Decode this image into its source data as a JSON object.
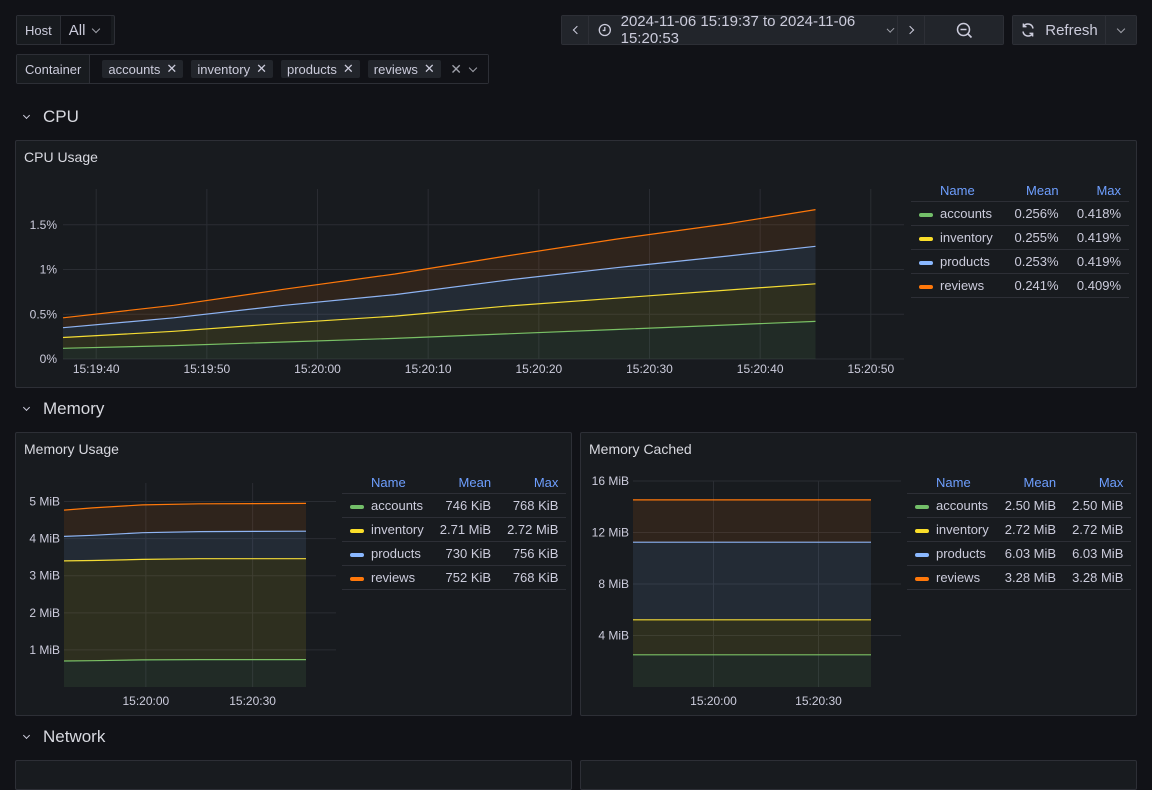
{
  "variables": {
    "host": {
      "label": "Host",
      "value": "All"
    },
    "container": {
      "label": "Container",
      "chips": [
        "accounts",
        "inventory",
        "products",
        "reviews"
      ]
    }
  },
  "toolbar": {
    "time_range": "2024-11-06 15:19:37 to 2024-11-06 15:20:53",
    "refresh_label": "Refresh"
  },
  "series_colors": {
    "accounts": "#73bf69",
    "inventory": "#fade2a",
    "products": "#8ab8ff",
    "reviews": "#ff780a"
  },
  "sections": [
    {
      "title": "CPU"
    },
    {
      "title": "Memory"
    },
    {
      "title": "Network"
    }
  ],
  "panels": {
    "cpu_usage": {
      "title": "CPU Usage",
      "legend": {
        "headers": [
          "Name",
          "Mean",
          "Max"
        ],
        "rows": [
          {
            "name": "accounts",
            "mean": "0.256%",
            "max": "0.418%"
          },
          {
            "name": "inventory",
            "mean": "0.255%",
            "max": "0.419%"
          },
          {
            "name": "products",
            "mean": "0.253%",
            "max": "0.419%"
          },
          {
            "name": "reviews",
            "mean": "0.241%",
            "max": "0.409%"
          }
        ]
      }
    },
    "memory_usage": {
      "title": "Memory Usage",
      "legend": {
        "headers": [
          "Name",
          "Mean",
          "Max"
        ],
        "rows": [
          {
            "name": "accounts",
            "mean": "746 KiB",
            "max": "768 KiB"
          },
          {
            "name": "inventory",
            "mean": "2.71 MiB",
            "max": "2.72 MiB"
          },
          {
            "name": "products",
            "mean": "730 KiB",
            "max": "756 KiB"
          },
          {
            "name": "reviews",
            "mean": "752 KiB",
            "max": "768 KiB"
          }
        ]
      }
    },
    "memory_cached": {
      "title": "Memory Cached",
      "legend": {
        "headers": [
          "Name",
          "Mean",
          "Max"
        ],
        "rows": [
          {
            "name": "accounts",
            "mean": "2.50 MiB",
            "max": "2.50 MiB"
          },
          {
            "name": "inventory",
            "mean": "2.72 MiB",
            "max": "2.72 MiB"
          },
          {
            "name": "products",
            "mean": "6.03 MiB",
            "max": "6.03 MiB"
          },
          {
            "name": "reviews",
            "mean": "3.28 MiB",
            "max": "3.28 MiB"
          }
        ]
      }
    }
  },
  "chart_data": [
    {
      "id": "cpu",
      "type": "area",
      "stacked": true,
      "title": "CPU Usage",
      "x_seconds": [
        0,
        10,
        20,
        30,
        40,
        50,
        60,
        68
      ],
      "x_origin": "15:19:37",
      "xlim": [
        0,
        76
      ],
      "xticks": [
        {
          "t": 3,
          "label": "15:19:40"
        },
        {
          "t": 13,
          "label": "15:19:50"
        },
        {
          "t": 23,
          "label": "15:20:00"
        },
        {
          "t": 33,
          "label": "15:20:10"
        },
        {
          "t": 43,
          "label": "15:20:20"
        },
        {
          "t": 53,
          "label": "15:20:30"
        },
        {
          "t": 63,
          "label": "15:20:40"
        },
        {
          "t": 73,
          "label": "15:20:50"
        }
      ],
      "ylim": [
        0,
        1.9
      ],
      "yticks": [
        {
          "v": 0,
          "label": "0%"
        },
        {
          "v": 0.5,
          "label": "0.5%"
        },
        {
          "v": 1,
          "label": "1%"
        },
        {
          "v": 1.5,
          "label": "1.5%"
        }
      ],
      "series": [
        {
          "name": "accounts",
          "values": [
            0.12,
            0.15,
            0.19,
            0.23,
            0.28,
            0.33,
            0.38,
            0.42
          ]
        },
        {
          "name": "inventory",
          "values": [
            0.12,
            0.16,
            0.21,
            0.25,
            0.31,
            0.35,
            0.39,
            0.42
          ]
        },
        {
          "name": "products",
          "values": [
            0.11,
            0.15,
            0.2,
            0.24,
            0.29,
            0.34,
            0.38,
            0.42
          ]
        },
        {
          "name": "reviews",
          "values": [
            0.11,
            0.14,
            0.18,
            0.23,
            0.27,
            0.32,
            0.36,
            0.41
          ]
        }
      ]
    },
    {
      "id": "memusage",
      "type": "area",
      "stacked": true,
      "title": "Memory Usage",
      "x_seconds": [
        0,
        8,
        22,
        38,
        68
      ],
      "xlim": [
        0,
        68
      ],
      "xticks": [
        {
          "t": 23,
          "label": "15:20:00"
        },
        {
          "t": 53,
          "label": "15:20:30"
        }
      ],
      "ylim": [
        0,
        5.5
      ],
      "yticks": [
        {
          "v": 1,
          "label": "1 MiB"
        },
        {
          "v": 2,
          "label": "2 MiB"
        },
        {
          "v": 3,
          "label": "3 MiB"
        },
        {
          "v": 4,
          "label": "4 MiB"
        },
        {
          "v": 5,
          "label": "5 MiB"
        }
      ],
      "series": [
        {
          "name": "accounts",
          "values": [
            0.7,
            0.71,
            0.73,
            0.74,
            0.74
          ]
        },
        {
          "name": "inventory",
          "values": [
            2.7,
            2.7,
            2.71,
            2.72,
            2.72
          ]
        },
        {
          "name": "products",
          "values": [
            0.66,
            0.68,
            0.72,
            0.73,
            0.74
          ]
        },
        {
          "name": "reviews",
          "values": [
            0.71,
            0.74,
            0.75,
            0.75,
            0.75
          ]
        }
      ]
    },
    {
      "id": "memcached",
      "type": "area",
      "stacked": true,
      "title": "Memory Cached",
      "x_seconds": [
        0,
        68
      ],
      "xlim": [
        0,
        68
      ],
      "xticks": [
        {
          "t": 23,
          "label": "15:20:00"
        },
        {
          "t": 53,
          "label": "15:20:30"
        }
      ],
      "ylim": [
        0,
        16
      ],
      "yticks": [
        {
          "v": 4,
          "label": "4 MiB"
        },
        {
          "v": 8,
          "label": "8 MiB"
        },
        {
          "v": 12,
          "label": "12 MiB"
        },
        {
          "v": 16,
          "label": "16 MiB"
        }
      ],
      "series": [
        {
          "name": "accounts",
          "values": [
            2.5,
            2.5
          ]
        },
        {
          "name": "inventory",
          "values": [
            2.72,
            2.72
          ]
        },
        {
          "name": "products",
          "values": [
            6.03,
            6.03
          ]
        },
        {
          "name": "reviews",
          "values": [
            3.28,
            3.28
          ]
        }
      ]
    }
  ]
}
